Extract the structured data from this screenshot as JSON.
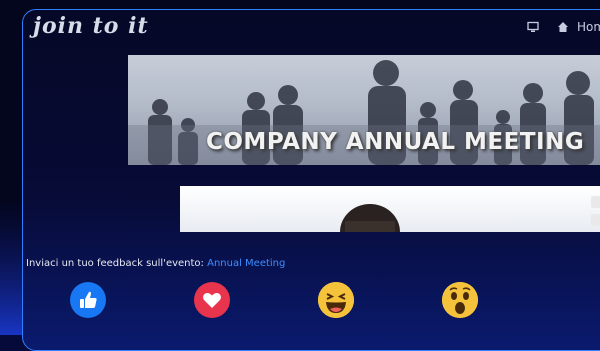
{
  "header": {
    "logo": "join to it",
    "nav_home_label": "Hom"
  },
  "banner": {
    "title": "COMPANY ANNUAL MEETING"
  },
  "feedback": {
    "prompt": "Inviaci un tuo feedback sull'evento:",
    "event_link": "Annual Meeting"
  },
  "reactions": [
    {
      "icon": "like-icon",
      "color": "#1877f2"
    },
    {
      "icon": "love-icon",
      "color": "#e8344c"
    },
    {
      "icon": "haha-icon",
      "color": "#f7c948"
    },
    {
      "icon": "wow-icon",
      "color": "#f7c948"
    }
  ],
  "colors": {
    "frame_border": "#2f7fff",
    "link": "#3f8cff",
    "background": "#060a3a"
  }
}
